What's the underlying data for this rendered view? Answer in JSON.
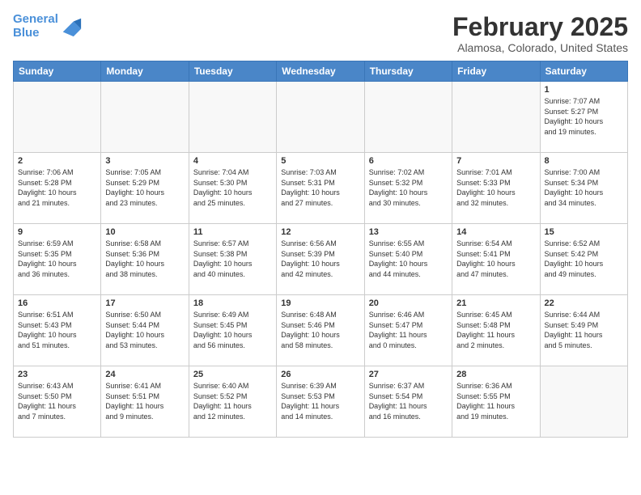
{
  "header": {
    "logo_line1": "General",
    "logo_line2": "Blue",
    "title": "February 2025",
    "subtitle": "Alamosa, Colorado, United States"
  },
  "weekdays": [
    "Sunday",
    "Monday",
    "Tuesday",
    "Wednesday",
    "Thursday",
    "Friday",
    "Saturday"
  ],
  "weeks": [
    [
      {
        "day": "",
        "info": ""
      },
      {
        "day": "",
        "info": ""
      },
      {
        "day": "",
        "info": ""
      },
      {
        "day": "",
        "info": ""
      },
      {
        "day": "",
        "info": ""
      },
      {
        "day": "",
        "info": ""
      },
      {
        "day": "1",
        "info": "Sunrise: 7:07 AM\nSunset: 5:27 PM\nDaylight: 10 hours\nand 19 minutes."
      }
    ],
    [
      {
        "day": "2",
        "info": "Sunrise: 7:06 AM\nSunset: 5:28 PM\nDaylight: 10 hours\nand 21 minutes."
      },
      {
        "day": "3",
        "info": "Sunrise: 7:05 AM\nSunset: 5:29 PM\nDaylight: 10 hours\nand 23 minutes."
      },
      {
        "day": "4",
        "info": "Sunrise: 7:04 AM\nSunset: 5:30 PM\nDaylight: 10 hours\nand 25 minutes."
      },
      {
        "day": "5",
        "info": "Sunrise: 7:03 AM\nSunset: 5:31 PM\nDaylight: 10 hours\nand 27 minutes."
      },
      {
        "day": "6",
        "info": "Sunrise: 7:02 AM\nSunset: 5:32 PM\nDaylight: 10 hours\nand 30 minutes."
      },
      {
        "day": "7",
        "info": "Sunrise: 7:01 AM\nSunset: 5:33 PM\nDaylight: 10 hours\nand 32 minutes."
      },
      {
        "day": "8",
        "info": "Sunrise: 7:00 AM\nSunset: 5:34 PM\nDaylight: 10 hours\nand 34 minutes."
      }
    ],
    [
      {
        "day": "9",
        "info": "Sunrise: 6:59 AM\nSunset: 5:35 PM\nDaylight: 10 hours\nand 36 minutes."
      },
      {
        "day": "10",
        "info": "Sunrise: 6:58 AM\nSunset: 5:36 PM\nDaylight: 10 hours\nand 38 minutes."
      },
      {
        "day": "11",
        "info": "Sunrise: 6:57 AM\nSunset: 5:38 PM\nDaylight: 10 hours\nand 40 minutes."
      },
      {
        "day": "12",
        "info": "Sunrise: 6:56 AM\nSunset: 5:39 PM\nDaylight: 10 hours\nand 42 minutes."
      },
      {
        "day": "13",
        "info": "Sunrise: 6:55 AM\nSunset: 5:40 PM\nDaylight: 10 hours\nand 44 minutes."
      },
      {
        "day": "14",
        "info": "Sunrise: 6:54 AM\nSunset: 5:41 PM\nDaylight: 10 hours\nand 47 minutes."
      },
      {
        "day": "15",
        "info": "Sunrise: 6:52 AM\nSunset: 5:42 PM\nDaylight: 10 hours\nand 49 minutes."
      }
    ],
    [
      {
        "day": "16",
        "info": "Sunrise: 6:51 AM\nSunset: 5:43 PM\nDaylight: 10 hours\nand 51 minutes."
      },
      {
        "day": "17",
        "info": "Sunrise: 6:50 AM\nSunset: 5:44 PM\nDaylight: 10 hours\nand 53 minutes."
      },
      {
        "day": "18",
        "info": "Sunrise: 6:49 AM\nSunset: 5:45 PM\nDaylight: 10 hours\nand 56 minutes."
      },
      {
        "day": "19",
        "info": "Sunrise: 6:48 AM\nSunset: 5:46 PM\nDaylight: 10 hours\nand 58 minutes."
      },
      {
        "day": "20",
        "info": "Sunrise: 6:46 AM\nSunset: 5:47 PM\nDaylight: 11 hours\nand 0 minutes."
      },
      {
        "day": "21",
        "info": "Sunrise: 6:45 AM\nSunset: 5:48 PM\nDaylight: 11 hours\nand 2 minutes."
      },
      {
        "day": "22",
        "info": "Sunrise: 6:44 AM\nSunset: 5:49 PM\nDaylight: 11 hours\nand 5 minutes."
      }
    ],
    [
      {
        "day": "23",
        "info": "Sunrise: 6:43 AM\nSunset: 5:50 PM\nDaylight: 11 hours\nand 7 minutes."
      },
      {
        "day": "24",
        "info": "Sunrise: 6:41 AM\nSunset: 5:51 PM\nDaylight: 11 hours\nand 9 minutes."
      },
      {
        "day": "25",
        "info": "Sunrise: 6:40 AM\nSunset: 5:52 PM\nDaylight: 11 hours\nand 12 minutes."
      },
      {
        "day": "26",
        "info": "Sunrise: 6:39 AM\nSunset: 5:53 PM\nDaylight: 11 hours\nand 14 minutes."
      },
      {
        "day": "27",
        "info": "Sunrise: 6:37 AM\nSunset: 5:54 PM\nDaylight: 11 hours\nand 16 minutes."
      },
      {
        "day": "28",
        "info": "Sunrise: 6:36 AM\nSunset: 5:55 PM\nDaylight: 11 hours\nand 19 minutes."
      },
      {
        "day": "",
        "info": ""
      }
    ]
  ]
}
